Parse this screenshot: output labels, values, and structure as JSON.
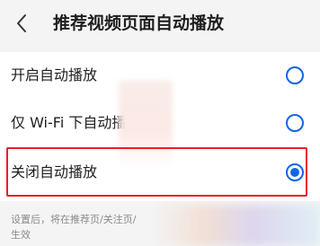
{
  "header": {
    "back_icon": "chevron-left-icon",
    "title": "推荐视频页面自动播放"
  },
  "options": [
    {
      "label": "开启自动播放",
      "selected": false
    },
    {
      "label": "仅 Wi-Fi 下自动播",
      "selected": false
    },
    {
      "label": "关闭自动播放",
      "selected": true
    }
  ],
  "footnote": {
    "line1": "设置后，将在推荐页/关注页/",
    "line2": "生效"
  },
  "colors": {
    "accent": "#1565e0",
    "highlight": "#e8202a"
  }
}
